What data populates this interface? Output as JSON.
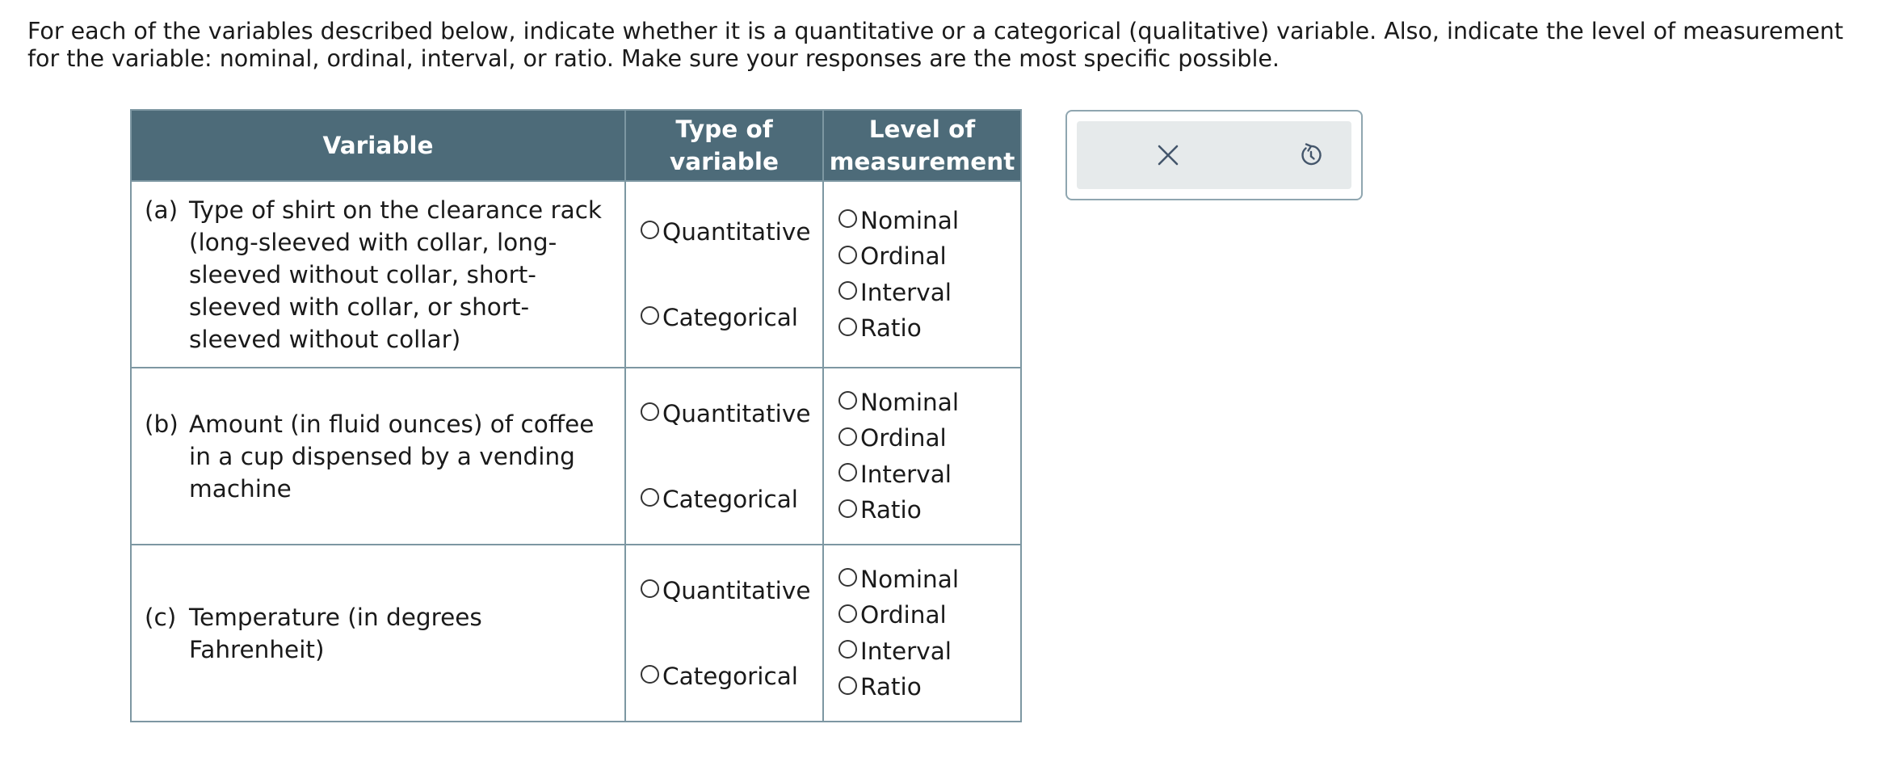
{
  "instructions": "For each of the variables described below, indicate whether it is a quantitative or a categorical (qualitative) variable. Also, indicate the level of measurement for the variable: nominal, ordinal, interval, or ratio. Make sure your responses are the most specific possible.",
  "table": {
    "headers": {
      "variable": "Variable",
      "type_line1": "Type of",
      "type_line2": "variable",
      "level_line1": "Level of",
      "level_line2": "measurement"
    },
    "rows": [
      {
        "letter": "(a)",
        "description": "Type of shirt on the clearance rack (long-sleeved with collar, long-sleeved without collar, short-sleeved with collar, or short-sleeved without collar)",
        "type_options": [
          "Quantitative",
          "Categorical"
        ],
        "level_options": [
          "Nominal",
          "Ordinal",
          "Interval",
          "Ratio"
        ]
      },
      {
        "letter": "(b)",
        "description": "Amount (in fluid ounces) of coffee in a cup dispensed by a vending machine",
        "type_options": [
          "Quantitative",
          "Categorical"
        ],
        "level_options": [
          "Nominal",
          "Ordinal",
          "Interval",
          "Ratio"
        ]
      },
      {
        "letter": "(c)",
        "description": "Temperature (in degrees Fahrenheit)",
        "type_options": [
          "Quantitative",
          "Categorical"
        ],
        "level_options": [
          "Nominal",
          "Ordinal",
          "Interval",
          "Ratio"
        ]
      }
    ]
  },
  "tools": {
    "clear_icon": "close-icon",
    "reset_icon": "undo-icon"
  }
}
